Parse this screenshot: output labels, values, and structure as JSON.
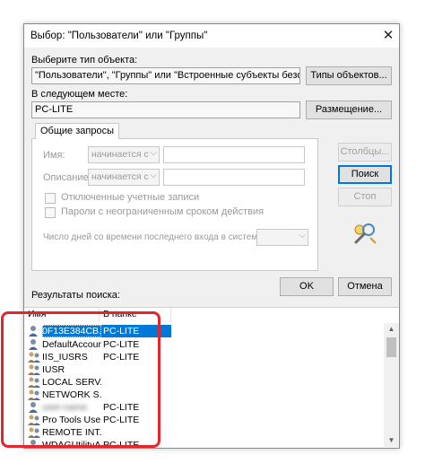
{
  "window": {
    "title": "Выбор: \"Пользователи\" или \"Группы\"",
    "close": "✕"
  },
  "object_type": {
    "label": "Выберите тип объекта:",
    "value": "\"Пользователи\", \"Группы\" или \"Встроенные субъекты безопасности\"",
    "button": "Типы объектов..."
  },
  "location": {
    "label": "В следующем месте:",
    "value": "PC-LITE",
    "button": "Размещение..."
  },
  "tab": {
    "label": "Общие запросы"
  },
  "query": {
    "name_label": "Имя:",
    "name_combo": "начинается с",
    "desc_label": "Описание:",
    "desc_combo": "начинается с",
    "disabled_accounts": "Отключенные учетные записи",
    "non_expiring_pw": "Пароли с неограниченным сроком действия",
    "days_label": "Число дней со времени последнего входа в систему:"
  },
  "side_buttons": {
    "columns": "Столбцы...",
    "search": "Поиск",
    "stop": "Стоп"
  },
  "dialog_buttons": {
    "ok": "OK",
    "cancel": "Отмена"
  },
  "results": {
    "label": "Результаты поиска:",
    "col_name": "Имя",
    "col_folder": "В папке",
    "rows": [
      {
        "name": "0F13E384CB...",
        "folder": "PC-LITE"
      },
      {
        "name": "DefaultAccount",
        "folder": "PC-LITE"
      },
      {
        "name": "IIS_IUSRS",
        "folder": "PC-LITE"
      },
      {
        "name": "IUSR",
        "folder": ""
      },
      {
        "name": "LOCAL SERV...",
        "folder": ""
      },
      {
        "name": "NETWORK S...",
        "folder": ""
      },
      {
        "name": "user-name",
        "folder": "PC-LITE"
      },
      {
        "name": "Pro Tools Use...",
        "folder": "PC-LITE"
      },
      {
        "name": "REMOTE INT...",
        "folder": ""
      },
      {
        "name": "WDAGUtilityA...",
        "folder": "PC-LITE"
      }
    ]
  }
}
